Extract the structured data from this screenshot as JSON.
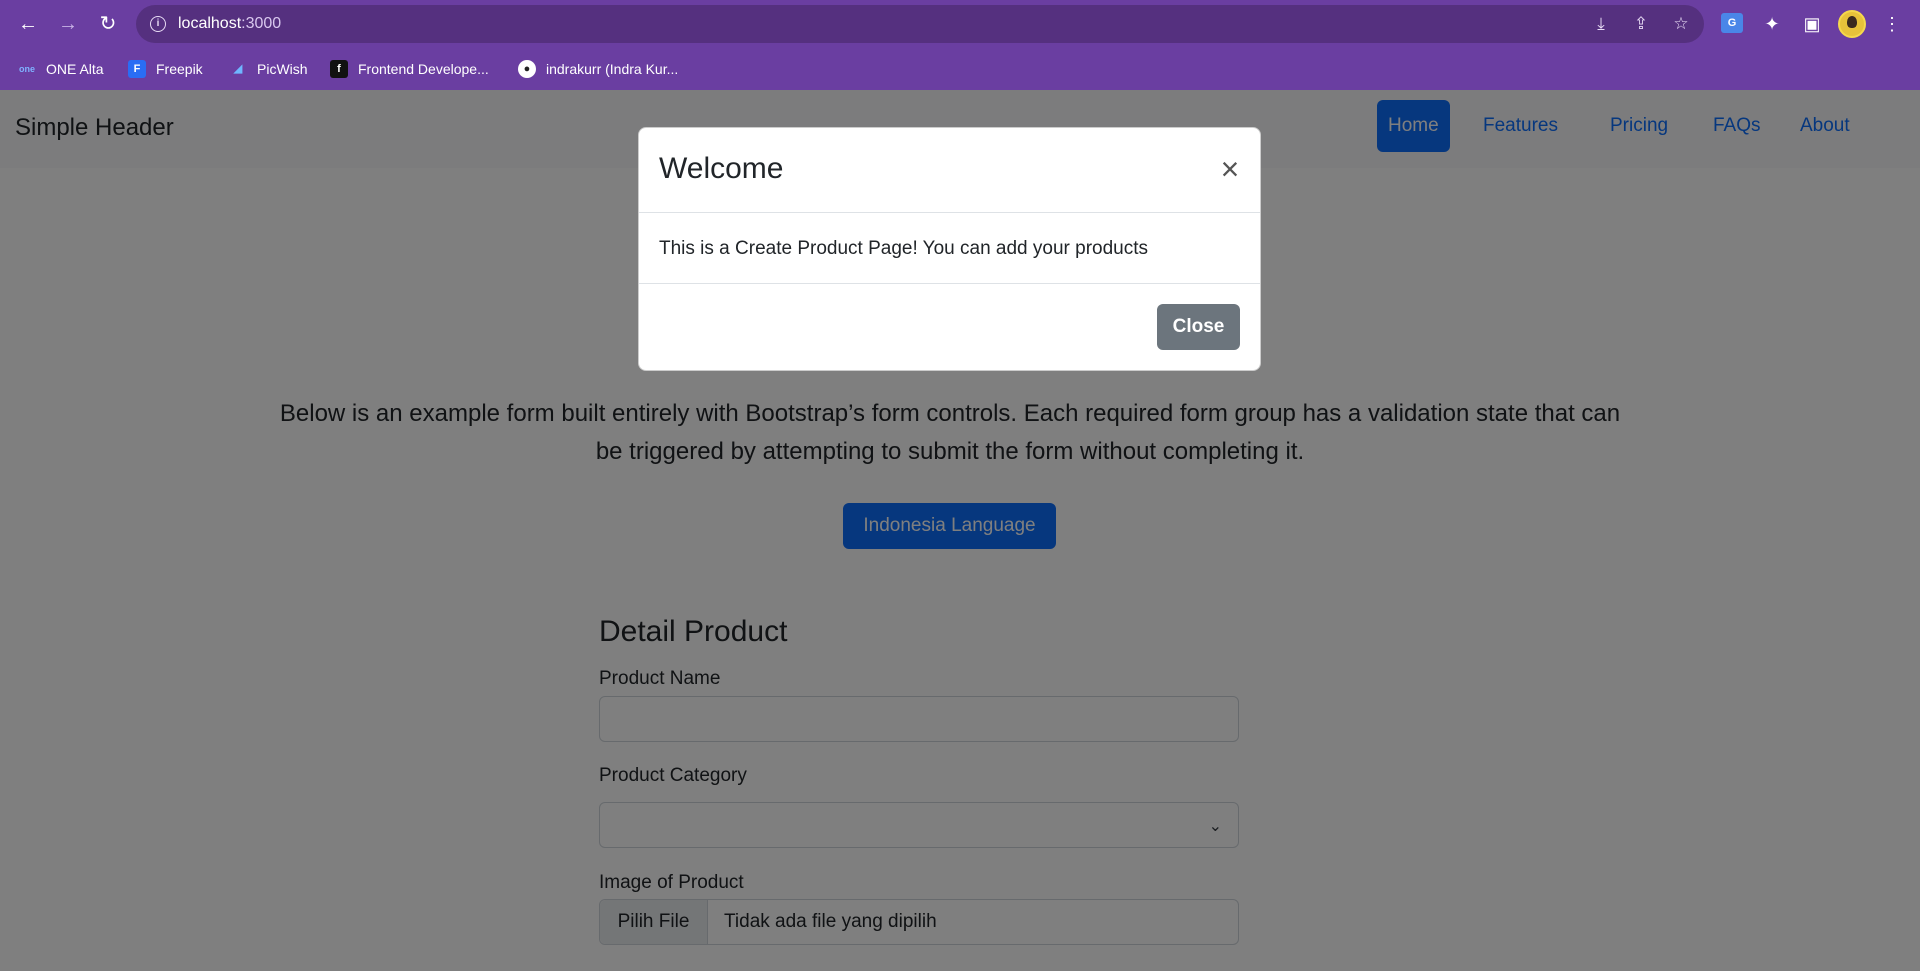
{
  "browser": {
    "url_host": "localhost",
    "url_port": ":3000",
    "bookmarks": [
      {
        "label": "ONE Alta",
        "icon": "one-alta-icon"
      },
      {
        "label": "Freepik",
        "icon": "freepik-icon"
      },
      {
        "label": "PicWish",
        "icon": "picwish-icon"
      },
      {
        "label": "Frontend Develope...",
        "icon": "frontend-icon"
      },
      {
        "label": "indrakurr (Indra Kur...",
        "icon": "github-icon"
      }
    ]
  },
  "header": {
    "brand": "Simple Header",
    "nav": [
      {
        "label": "Home",
        "active": true
      },
      {
        "label": "Features",
        "active": false
      },
      {
        "label": "Pricing",
        "active": false
      },
      {
        "label": "FAQs",
        "active": false
      },
      {
        "label": "About",
        "active": false
      }
    ]
  },
  "main": {
    "lead_line1": "Below is an example form built entirely with Bootstrap’s form controls. Each required form group has a validation state that can",
    "lead_line2": "be triggered by attempting to submit the form without completing it.",
    "language_button": "Indonesia Language"
  },
  "form": {
    "title": "Detail Product",
    "product_name_label": "Product Name",
    "product_name_value": "",
    "product_category_label": "Product Category",
    "product_category_value": "",
    "image_label": "Image of Product",
    "file_button": "Pilih File",
    "file_status": "Tidak ada file yang dipilih"
  },
  "modal": {
    "title": "Welcome",
    "body": "This is a Create Product Page! You can add your products",
    "close_button": "Close"
  },
  "colors": {
    "chrome": "#6a3ea1",
    "primary": "#0d6efd",
    "secondary": "#6c757d"
  }
}
